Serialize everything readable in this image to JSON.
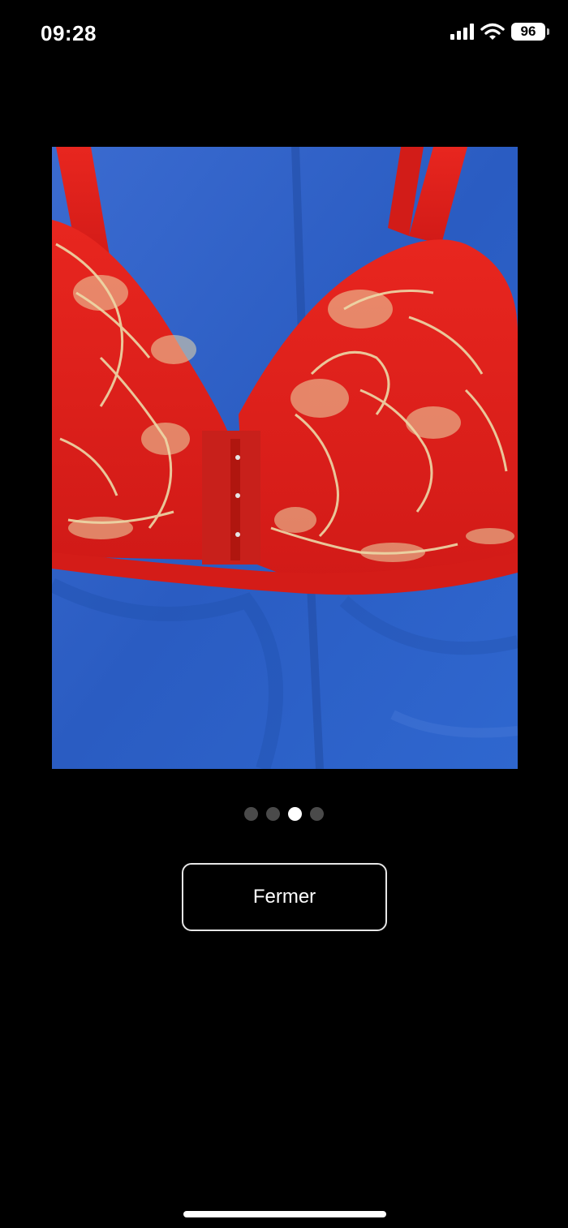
{
  "status_bar": {
    "time": "09:28",
    "battery": "96",
    "icons": [
      "signal-icon",
      "wifi-icon",
      "battery-icon"
    ]
  },
  "viewer": {
    "slide_count": 4,
    "active_index": 2,
    "close_label": "Fermer"
  },
  "colors": {
    "background": "#000000",
    "fabric_blue": "#2d5fc4",
    "garment_red": "#e0201c",
    "embroidery_gold": "#ecd9a8",
    "dot_inactive": "#4a4a4a",
    "dot_active": "#ffffff"
  }
}
